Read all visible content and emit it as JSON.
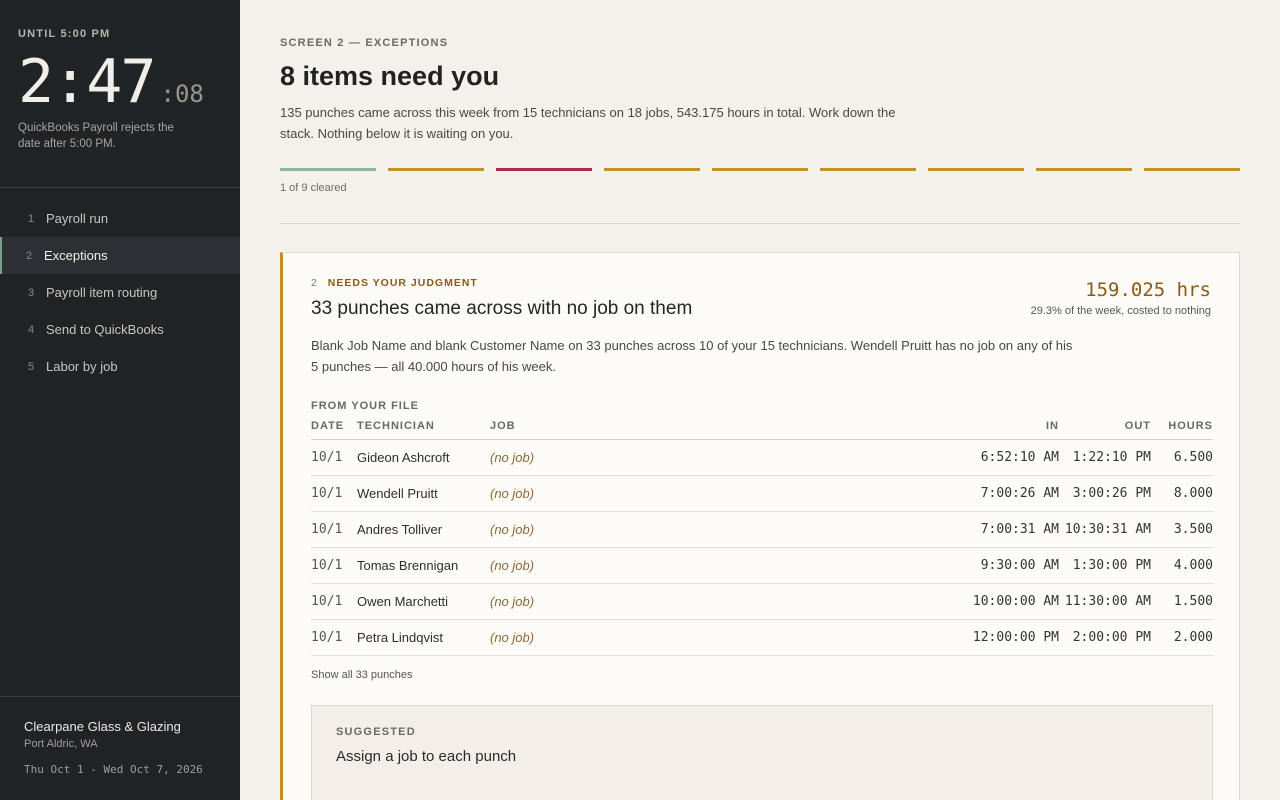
{
  "sidebar": {
    "deadline_label": "UNTIL 5:00 PM",
    "clock_hm": "2:47",
    "clock_sec": ":08",
    "deadline_note": "QuickBooks Payroll rejects the date after 5:00 PM.",
    "nav": [
      {
        "num": "1",
        "label": "Payroll run"
      },
      {
        "num": "2",
        "label": "Exceptions"
      },
      {
        "num": "3",
        "label": "Payroll item routing"
      },
      {
        "num": "4",
        "label": "Send to QuickBooks"
      },
      {
        "num": "5",
        "label": "Labor by job"
      }
    ],
    "company_name": "Clearpane Glass & Glazing",
    "company_location": "Port Aldric, WA",
    "date_range": "Thu Oct 1 - Wed Oct 7, 2026"
  },
  "header": {
    "screen_label": "SCREEN 2 — EXCEPTIONS",
    "title": "8 items need you",
    "description": "135 punches came across this week from 15 technicians on 18 jobs, 543.175 hours in total. Work down the stack. Nothing below it is waiting on you.",
    "progress_label": "1 of 9 cleared",
    "progress": {
      "cleared": 1,
      "total": 9
    }
  },
  "card": {
    "number": "2",
    "tag": "NEEDS YOUR JUDGMENT",
    "title": "33 punches came across with no job on them",
    "metric_value": "159.025 hrs",
    "metric_sub": "29.3% of the week, costed to nothing",
    "description": "Blank Job Name and blank Customer Name on 33 punches across 10 of your 15 technicians. Wendell Pruitt has no job on any of his 5 punches — all 40.000 hours of his week.",
    "file_label": "FROM YOUR FILE",
    "columns": {
      "date": "DATE",
      "technician": "TECHNICIAN",
      "job": "JOB",
      "in": "IN",
      "out": "OUT",
      "hours": "HOURS"
    },
    "rows": [
      {
        "date": "10/1",
        "technician": "Gideon Ashcroft",
        "job": "(no job)",
        "in": "6:52:10 AM",
        "out": "1:22:10 PM",
        "hours": "6.500"
      },
      {
        "date": "10/1",
        "technician": "Wendell Pruitt",
        "job": "(no job)",
        "in": "7:00:26 AM",
        "out": "3:00:26 PM",
        "hours": "8.000"
      },
      {
        "date": "10/1",
        "technician": "Andres Tolliver",
        "job": "(no job)",
        "in": "7:00:31 AM",
        "out": "10:30:31 AM",
        "hours": "3.500"
      },
      {
        "date": "10/1",
        "technician": "Tomas Brennigan",
        "job": "(no job)",
        "in": "9:30:00 AM",
        "out": "1:30:00 PM",
        "hours": "4.000"
      },
      {
        "date": "10/1",
        "technician": "Owen Marchetti",
        "job": "(no job)",
        "in": "10:00:00 AM",
        "out": "11:30:00 AM",
        "hours": "1.500"
      },
      {
        "date": "10/1",
        "technician": "Petra Lindqvist",
        "job": "(no job)",
        "in": "12:00:00 PM",
        "out": "2:00:00 PM",
        "hours": "2.000"
      }
    ],
    "show_all": "Show all 33 punches",
    "suggest_label": "SUGGESTED",
    "suggest_title": "Assign a job to each punch"
  },
  "colors": {
    "accent": "#c98f26",
    "cleared": "#8fb3a1",
    "current": "#a3324a",
    "sidebar_bg": "#212427"
  }
}
